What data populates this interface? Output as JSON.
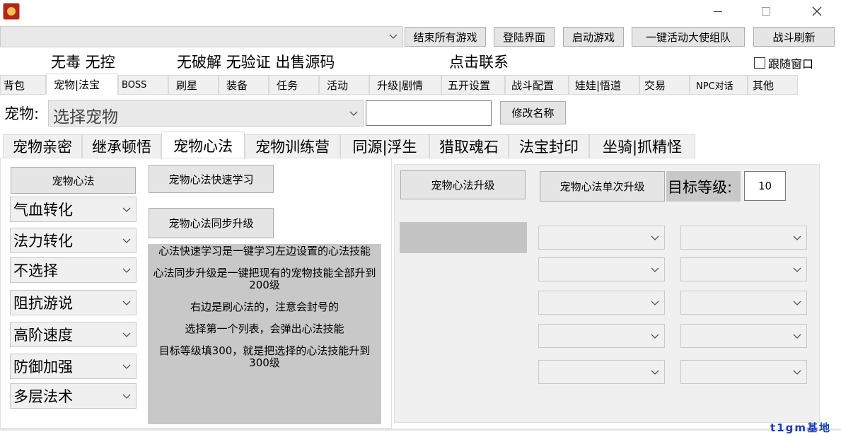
{
  "toolbar": {
    "end_all_games": "结束所有游戏",
    "login_screen": "登陆界面",
    "start_game": "启动游戏",
    "one_click_team": "一键活动大使组队",
    "battle_refresh": "战斗刷新"
  },
  "promo": {
    "item1": "无毒 无控",
    "item2": "无破解 无验证 出售源码",
    "item3": "点击联系"
  },
  "follow_window": "跟随窗口",
  "main_tabs": [
    "背包",
    "宠物|法宝",
    "BOSS",
    "刷星",
    "装备",
    "任务",
    "活动",
    "升级|剧情",
    "五开设置",
    "战斗配置",
    "娃娃|悟道",
    "交易",
    "NPC对话",
    "其他"
  ],
  "pet": {
    "label": "宠物:",
    "placeholder": "选择宠物",
    "rename": "修改名称"
  },
  "sub_tabs": [
    "宠物亲密",
    "继承顿悟",
    "宠物心法",
    "宠物训练营",
    "同源|浮生",
    "猎取魂石",
    "法宝封印",
    "坐骑|抓精怪"
  ],
  "left": {
    "heart_method": "宠物心法",
    "quick_learn": "宠物心法快速学习",
    "sync_upgrade": "宠物心法同步升级",
    "skills": [
      "气血转化",
      "法力转化",
      "不选择",
      "阻抗游说",
      "高阶速度",
      "防御加强",
      "多层法术"
    ],
    "info": [
      "心法快速学习是一键学习左边设置的心法技能",
      "心法同步升级是一键把现有的宠物技能全部升到200级",
      "右边是刷心法的，注意会封号的",
      "选择第一个列表，会弹出心法技能",
      "目标等级填300，就是把选择的心法技能升到300级"
    ]
  },
  "right": {
    "upgrade": "宠物心法升级",
    "single_upgrade": "宠物心法单次升级",
    "target_level_label": "目标等级:",
    "target_level_value": "10"
  },
  "watermark": "t1gm基地"
}
